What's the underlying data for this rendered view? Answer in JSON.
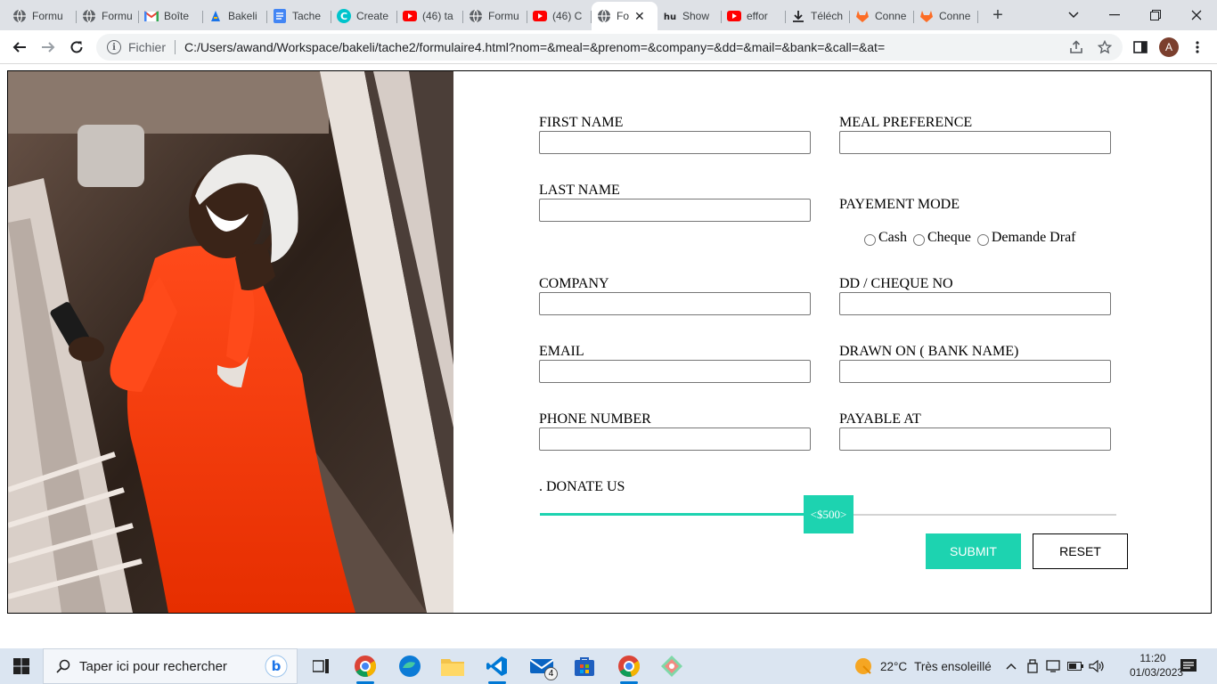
{
  "browser": {
    "tabs": [
      {
        "label": "Formu",
        "icon": "globe-icon"
      },
      {
        "label": "Formu",
        "icon": "globe-icon"
      },
      {
        "label": "Boîte",
        "icon": "gmail-icon"
      },
      {
        "label": "Bakeli",
        "icon": "bakeli-icon"
      },
      {
        "label": "Tache",
        "icon": "docs-icon"
      },
      {
        "label": "Create",
        "icon": "canva-icon"
      },
      {
        "label": "(46) ta",
        "icon": "youtube-icon"
      },
      {
        "label": "Formu",
        "icon": "globe-icon"
      },
      {
        "label": "(46) C",
        "icon": "youtube-icon"
      },
      {
        "label": "Fo",
        "icon": "globe-icon",
        "active": true
      },
      {
        "label": "Show",
        "icon": "hu-icon"
      },
      {
        "label": "effor",
        "icon": "youtube-icon"
      },
      {
        "label": "Téléch",
        "icon": "download-icon"
      },
      {
        "label": "Conne",
        "icon": "gitlab-icon"
      },
      {
        "label": "Conne",
        "icon": "gitlab-icon"
      }
    ],
    "address": {
      "scheme": "Fichier",
      "url": "C:/Users/awand/Workspace/bakeli/tache2/formulaire4.html?nom=&meal=&prenom=&company=&dd=&mail=&bank=&call=&at="
    },
    "profile_initial": "A"
  },
  "form": {
    "first_name_label": "FIRST NAME",
    "meal_label": "MEAL PREFERENCE",
    "last_name_label": "LAST NAME",
    "payment_label": "PAYEMENT MODE",
    "payment_options": {
      "cash": "Cash",
      "cheque": "Cheque",
      "draft": "Demande Draf"
    },
    "company_label": "COMPANY",
    "dd_label": "DD / CHEQUE NO",
    "email_label": "EMAIL",
    "bank_label": "DRAWN ON ( BANK NAME)",
    "phone_label": "PHONE NUMBER",
    "payable_label": "PAYABLE AT",
    "donate_label": ". DONATE US",
    "donate_value_text": "<$500>",
    "donate_fraction": 0.46,
    "submit_label": "SUBMIT",
    "reset_label": "RESET",
    "accent_color": "#1dd3b0"
  },
  "taskbar": {
    "search_placeholder": "Taper ici pour rechercher",
    "weather_temp": "22°C",
    "weather_text": "Très ensoleillé",
    "time": "11:20",
    "date": "01/03/2023",
    "mail_badge": "4"
  }
}
